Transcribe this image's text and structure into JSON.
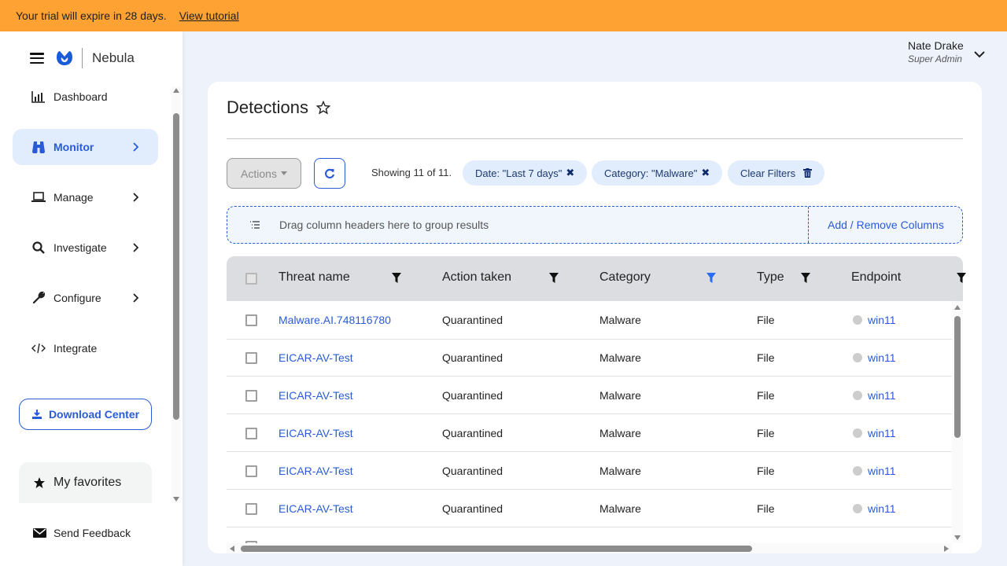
{
  "banner": {
    "message": "Your trial will expire in 28 days.",
    "link": "View tutorial",
    "color": "#fea333"
  },
  "brand": {
    "name": "Nebula",
    "logo_icon": "malwarebytes-logo-icon",
    "accent": "#2a5bd7"
  },
  "sidebar": {
    "items": [
      {
        "label": "Dashboard",
        "icon": "bar-chart-icon",
        "has_submenu": false,
        "active": false
      },
      {
        "label": "Monitor",
        "icon": "binoculars-icon",
        "has_submenu": true,
        "active": true
      },
      {
        "label": "Manage",
        "icon": "laptop-icon",
        "has_submenu": true,
        "active": false
      },
      {
        "label": "Investigate",
        "icon": "search-icon",
        "has_submenu": true,
        "active": false
      },
      {
        "label": "Configure",
        "icon": "wrench-icon",
        "has_submenu": true,
        "active": false
      },
      {
        "label": "Integrate",
        "icon": "code-icon",
        "has_submenu": false,
        "active": false
      }
    ],
    "download_center": "Download Center",
    "favorites": "My favorites",
    "feedback": "Send Feedback"
  },
  "user": {
    "name": "Nate Drake",
    "role": "Super Admin"
  },
  "page": {
    "title": "Detections",
    "actions_label": "Actions",
    "showing": "Showing 11 of 11.",
    "filters": [
      {
        "label": "Date: \"Last 7 days\""
      },
      {
        "label": "Category: \"Malware\""
      }
    ],
    "clear_filters": "Clear Filters",
    "group_hint": "Drag column headers here to group results",
    "add_remove_columns": "Add / Remove Columns"
  },
  "table": {
    "columns": [
      {
        "label": "Threat name",
        "filter_active": false
      },
      {
        "label": "Action taken",
        "filter_active": false
      },
      {
        "label": "Category",
        "filter_active": true
      },
      {
        "label": "Type",
        "filter_active": false
      },
      {
        "label": "Endpoint",
        "filter_active": false
      }
    ],
    "rows": [
      {
        "threat": "Malware.AI.748116780",
        "action": "Quarantined",
        "category": "Malware",
        "type": "File",
        "endpoint": "win11"
      },
      {
        "threat": "EICAR-AV-Test",
        "action": "Quarantined",
        "category": "Malware",
        "type": "File",
        "endpoint": "win11"
      },
      {
        "threat": "EICAR-AV-Test",
        "action": "Quarantined",
        "category": "Malware",
        "type": "File",
        "endpoint": "win11"
      },
      {
        "threat": "EICAR-AV-Test",
        "action": "Quarantined",
        "category": "Malware",
        "type": "File",
        "endpoint": "win11"
      },
      {
        "threat": "EICAR-AV-Test",
        "action": "Quarantined",
        "category": "Malware",
        "type": "File",
        "endpoint": "win11"
      },
      {
        "threat": "EICAR-AV-Test",
        "action": "Quarantined",
        "category": "Malware",
        "type": "File",
        "endpoint": "win11"
      },
      {
        "threat": "",
        "action": "",
        "category": "",
        "type": "",
        "endpoint": ""
      }
    ]
  }
}
